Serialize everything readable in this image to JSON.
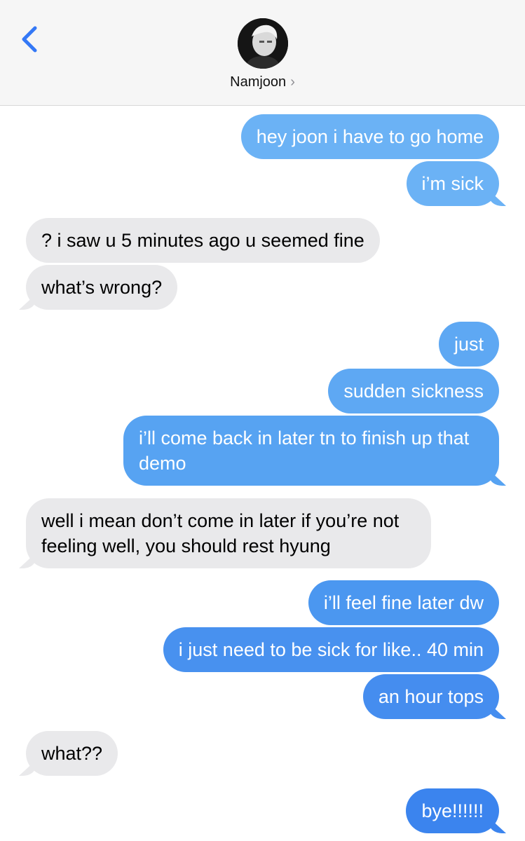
{
  "header": {
    "contact_name": "Namjoon",
    "chevron": "›",
    "back_icon": "chevron-left-icon",
    "accent": "#3478f6",
    "bar_color": "#f6f6f6"
  },
  "messages": [
    {
      "from": "me",
      "text": "hey joon i have to go home",
      "color": "#6bb2f5"
    },
    {
      "from": "me",
      "text": "i’m sick",
      "color": "#6bb2f5"
    },
    {
      "from": "them",
      "text": "? i saw u 5 minutes ago u seemed fine"
    },
    {
      "from": "them",
      "text": "what’s wrong?"
    },
    {
      "from": "me",
      "text": "just",
      "color": "#5ea8f3"
    },
    {
      "from": "me",
      "text": "sudden sickness",
      "color": "#5ea8f3"
    },
    {
      "from": "me",
      "text": "i’ll come back in later tn to finish up that demo",
      "color": "#57a3f2"
    },
    {
      "from": "them",
      "text": "well i mean don’t come in later if you’re not feeling well, you should rest hyung"
    },
    {
      "from": "me",
      "text": "i’ll feel fine later dw",
      "color": "#4b97f0"
    },
    {
      "from": "me",
      "text": "i just need to be sick for like.. 40 min",
      "color": "#4891ef"
    },
    {
      "from": "me",
      "text": "an hour tops",
      "color": "#458def"
    },
    {
      "from": "them",
      "text": "what??"
    },
    {
      "from": "me",
      "text": "bye!!!!!!",
      "color": "#3b84ee"
    }
  ]
}
